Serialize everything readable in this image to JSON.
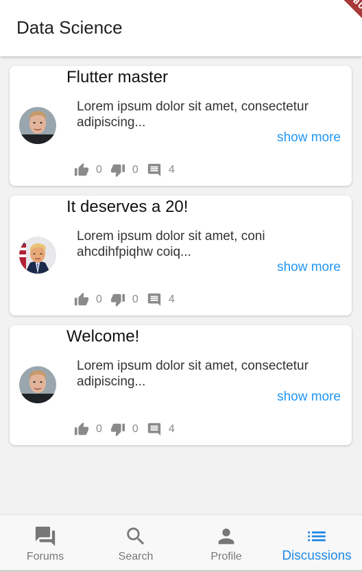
{
  "appbar": {
    "title": "Data Science",
    "debug_label": "DEBUG"
  },
  "posts": [
    {
      "title": "Flutter master",
      "body": "Lorem ipsum dolor sit amet, consectetur adipiscing...",
      "show_more": "show more",
      "likes": "0",
      "dislikes": "0",
      "comments": "4",
      "avatar": "man-blond-avatar"
    },
    {
      "title": "It deserves a 20!",
      "body": "Lorem ipsum dolor sit amet, coni ahcdihfpiqhw coiq...",
      "show_more": "show more",
      "likes": "0",
      "dislikes": "0",
      "comments": "4",
      "avatar": "man-suit-flag-avatar"
    },
    {
      "title": "Welcome!",
      "body": "Lorem ipsum dolor sit amet, consectetur adipiscing...",
      "show_more": "show more",
      "likes": "0",
      "dislikes": "0",
      "comments": "4",
      "avatar": "man-blond-avatar"
    }
  ],
  "bottom_nav": {
    "items": [
      {
        "label": "Forums",
        "icon": "forum-icon"
      },
      {
        "label": "Search",
        "icon": "search-icon"
      },
      {
        "label": "Profile",
        "icon": "person-icon"
      },
      {
        "label": "Discussions",
        "icon": "list-icon"
      }
    ],
    "active_index": 3
  },
  "colors": {
    "accent": "#2196f3",
    "active_nav": "#1e88e5",
    "inactive_nav": "#777777",
    "stat_gray": "#8a8a8a",
    "debug_ribbon": "#a83a3a"
  }
}
